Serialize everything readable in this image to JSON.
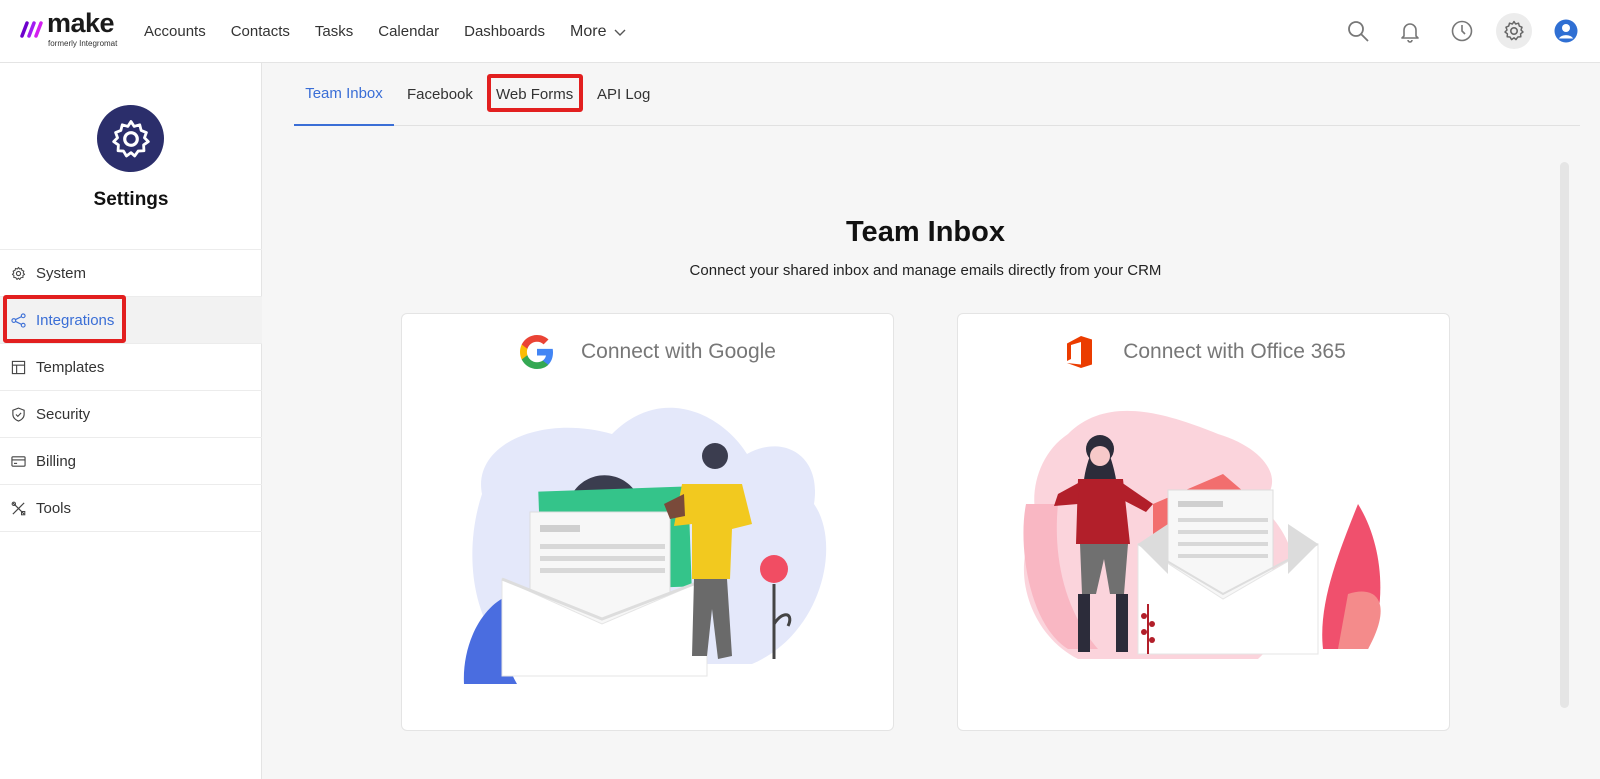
{
  "topbar": {
    "logo_word": "make",
    "logo_sub": "formerly Integromat",
    "nav": [
      "Accounts",
      "Contacts",
      "Tasks",
      "Calendar",
      "Dashboards"
    ],
    "more_label": "More",
    "icons": [
      "search-icon",
      "bell-icon",
      "clock-icon",
      "gear-icon",
      "user-avatar-icon"
    ]
  },
  "sidebar": {
    "title": "Settings",
    "items": [
      {
        "label": "System",
        "icon": "gear-icon"
      },
      {
        "label": "Integrations",
        "icon": "share-icon"
      },
      {
        "label": "Templates",
        "icon": "template-icon"
      },
      {
        "label": "Security",
        "icon": "shield-icon"
      },
      {
        "label": "Billing",
        "icon": "card-icon"
      },
      {
        "label": "Tools",
        "icon": "tools-icon"
      }
    ],
    "active": "Integrations"
  },
  "tabs": {
    "items": [
      "Team Inbox",
      "Facebook",
      "Web Forms",
      "API Log"
    ],
    "active": "Team Inbox"
  },
  "main": {
    "title": "Team Inbox",
    "subtitle": "Connect your shared inbox and manage emails directly from your CRM",
    "google_label": "Connect with Google",
    "office_label": "Connect with Office 365"
  },
  "colors": {
    "accent": "#3a6ed6",
    "highlight": "#e21f1f",
    "settings_badge": "#2b2e6b"
  }
}
